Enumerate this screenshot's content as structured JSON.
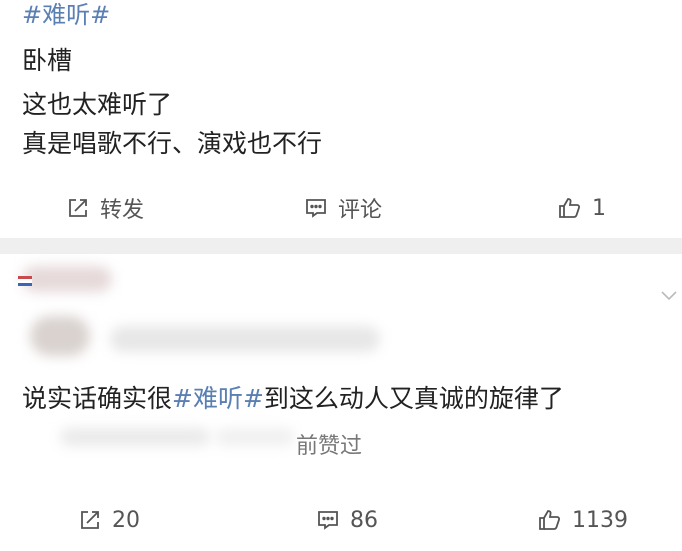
{
  "post": {
    "hashtag": "#难听#",
    "lines": [
      "卧槽",
      "这也太难听了",
      "真是唱歌不行、演戏也不行"
    ],
    "actions": {
      "repost_label": "转发",
      "comment_label": "评论",
      "like_count": "1"
    }
  },
  "comment": {
    "text_before": "说实话确实很",
    "hashtag": "#难听#",
    "text_after": "到这么动人又真诚的旋律了",
    "liked_text": "前赞过",
    "actions": {
      "repost_count": "20",
      "comment_count": "86",
      "like_count": "1139"
    }
  },
  "colors": {
    "link": "#5a7fb3",
    "divider": "#efefef"
  }
}
